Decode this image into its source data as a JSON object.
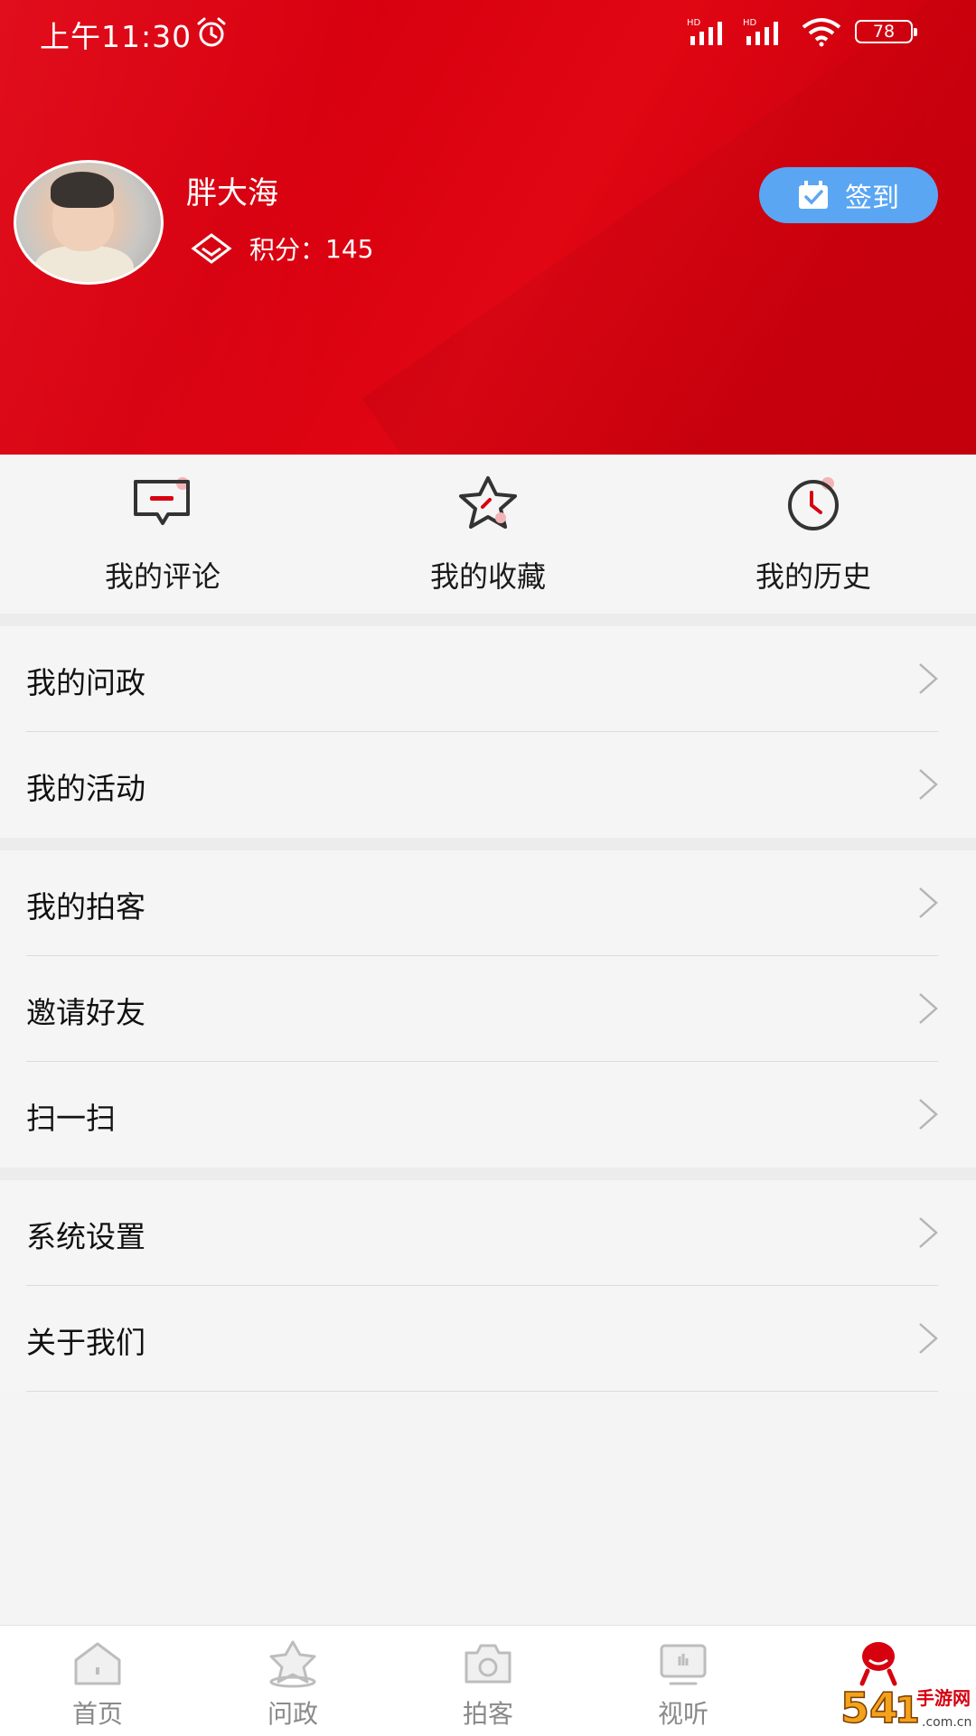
{
  "status_bar": {
    "time": "上午11:30",
    "battery": "78"
  },
  "profile": {
    "username": "胖大海",
    "points_label": "积分：",
    "points_value": "145",
    "checkin_label": "签到"
  },
  "quick_actions": [
    {
      "label": "我的评论",
      "icon": "comment-icon"
    },
    {
      "label": "我的收藏",
      "icon": "star-icon"
    },
    {
      "label": "我的历史",
      "icon": "clock-icon"
    }
  ],
  "menu_groups": [
    [
      {
        "label": "我的问政"
      },
      {
        "label": "我的活动"
      }
    ],
    [
      {
        "label": "我的拍客"
      },
      {
        "label": "邀请好友"
      },
      {
        "label": "扫一扫"
      }
    ],
    [
      {
        "label": "系统设置"
      },
      {
        "label": "关于我们"
      }
    ]
  ],
  "bottom_nav": [
    {
      "label": "首页",
      "icon": "home-icon"
    },
    {
      "label": "问政",
      "icon": "ask-government-icon"
    },
    {
      "label": "拍客",
      "icon": "camera-icon"
    },
    {
      "label": "视听",
      "icon": "tv-icon"
    },
    {
      "label": "",
      "icon": "profile-mascot-icon"
    }
  ],
  "colors": {
    "header_red": "#e00514",
    "checkin_blue": "#5aa6f3",
    "accent_red": "#d7000f"
  }
}
